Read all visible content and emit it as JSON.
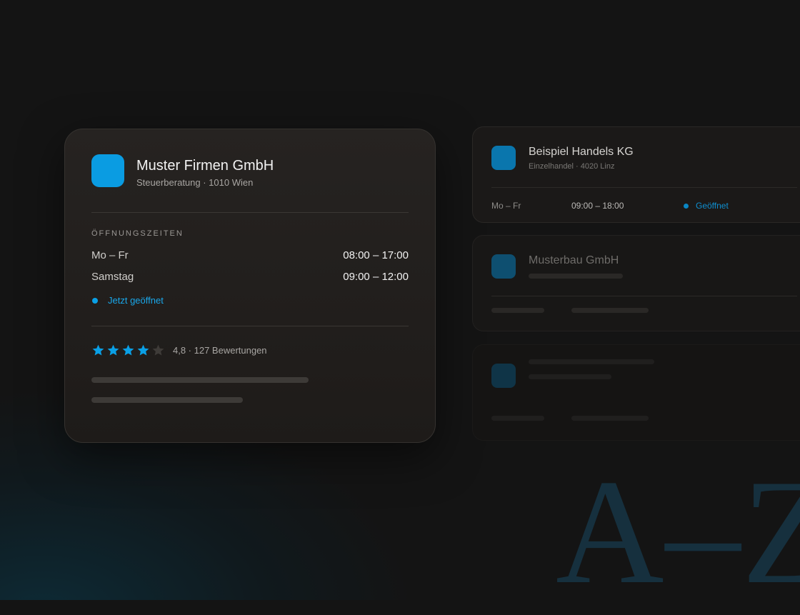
{
  "background": {
    "watermark": "A–Z"
  },
  "colors": {
    "accent": "#0a9ce2",
    "open_status": "#1aa7ea",
    "star_empty": "#3e3b38"
  },
  "featured": {
    "logo_icon": "company-logo-icon",
    "name": "Muster Firmen GmbH",
    "subtitle": "Steuerberatung · 1010 Wien",
    "hours_label": "ÖFFNUNGSZEITEN",
    "hours": [
      {
        "day": "Mo – Fr",
        "time": "08:00 – 17:00"
      },
      {
        "day": "Samstag",
        "time": "09:00 – 12:00"
      }
    ],
    "status": "Jetzt geöffnet",
    "rating": {
      "stars_filled": 4,
      "stars_total": 5,
      "text": "4,8 · 127 Bewertungen"
    }
  },
  "listings": [
    {
      "name": "Beispiel Handels KG",
      "subtitle": "Einzelhandel · 4020 Linz",
      "day": "Mo – Fr",
      "time": "09:00 – 18:00",
      "status": "Geöffnet"
    },
    {
      "name": "Musterbau GmbH"
    }
  ]
}
